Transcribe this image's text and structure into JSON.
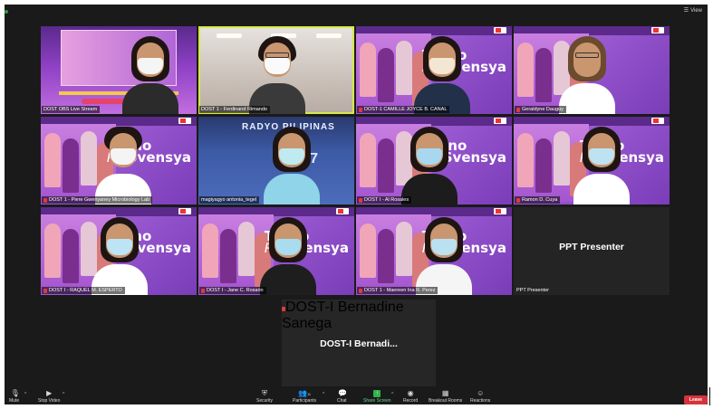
{
  "window": {
    "view_label": "View"
  },
  "participants": [
    {
      "name": "DOST OBS Live Stream",
      "muted": false
    },
    {
      "name": "DOST 1 - Ferdinand Rimando",
      "muted": false
    },
    {
      "name": "DOST-1 CAMILLE JOYCE B. CANAL",
      "muted": true
    },
    {
      "name": "Geraldyne Dauguy",
      "muted": true
    },
    {
      "name": "DOST 1 - Piere Gwenyaney Microbiology Lab",
      "muted": true
    },
    {
      "name": "magiyagyo antonia_tegel",
      "muted": false
    },
    {
      "name": "DOST I - Al Rosales",
      "muted": true
    },
    {
      "name": "Ramon D. Cuya",
      "muted": true
    },
    {
      "name": "DOST I - RAQUEL M. ESPERTO",
      "muted": true
    },
    {
      "name": "DOST I - Jane C. Rosario",
      "muted": true
    },
    {
      "name": "DOST 1 - Maereen Ina R. Perez",
      "muted": true
    },
    {
      "name": "PPT Presenter",
      "muted": false
    }
  ],
  "ppt_presenter": {
    "label": "PPT Presenter"
  },
  "spotlight": {
    "label": "DOST-I  Bernadi...",
    "name": "DOST-I Bernadine Sanega"
  },
  "branding": {
    "tekno": "Tekno",
    "pre": "Pre",
    "svensya": "Svensya",
    "radio": "RADYO PILIPINAS",
    "freq": "97"
  },
  "toolbar": {
    "mute": "Mute",
    "stop_video": "Stop Video",
    "security": "Security",
    "participants": "Participants",
    "participants_count": "11",
    "chat": "Chat",
    "share_screen": "Share Screen",
    "record": "Record",
    "breakout_rooms": "Breakout Rooms",
    "reactions": "Reactions",
    "leave": "Leave"
  },
  "colors": {
    "accent_active": "#d7e84a",
    "leave": "#d6333b",
    "share": "#2fb44a",
    "brand_purple": "#9b5cc9"
  }
}
